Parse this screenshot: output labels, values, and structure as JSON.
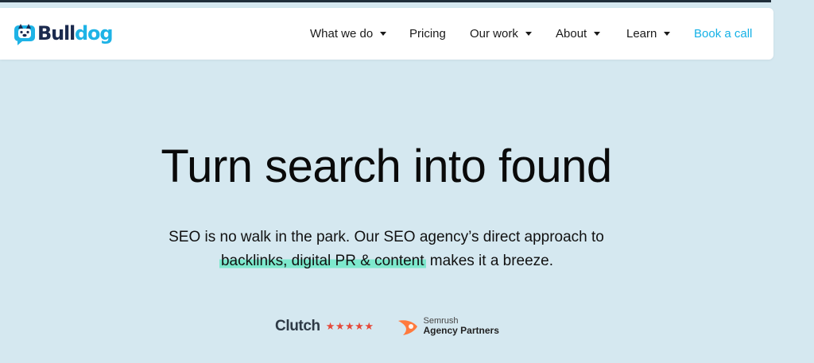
{
  "brand": {
    "name_part1": "Bull",
    "name_part2": "dog",
    "accent_color": "#1eb3e6",
    "dark_color": "#1b2a4e"
  },
  "nav": {
    "items": [
      {
        "label": "What we do",
        "has_dropdown": true
      },
      {
        "label": "Pricing",
        "has_dropdown": false
      },
      {
        "label": "Our work",
        "has_dropdown": true
      },
      {
        "label": "About",
        "has_dropdown": true
      },
      {
        "label": "Learn",
        "has_dropdown": true
      }
    ],
    "cta_label": "Book a call"
  },
  "hero": {
    "title": "Turn search into found",
    "subtitle_line1": "SEO is no walk in the park. Our SEO agency’s direct approach to",
    "subtitle_highlight": "backlinks, digital PR & content",
    "subtitle_tail": " makes it a breeze.",
    "highlight_color": "#7ee8cd"
  },
  "badges": {
    "clutch_label": "Clutch",
    "clutch_rating": 5,
    "stars": "★★★★★",
    "semrush_line1": "Semrush",
    "semrush_line2": "Agency Partners"
  }
}
